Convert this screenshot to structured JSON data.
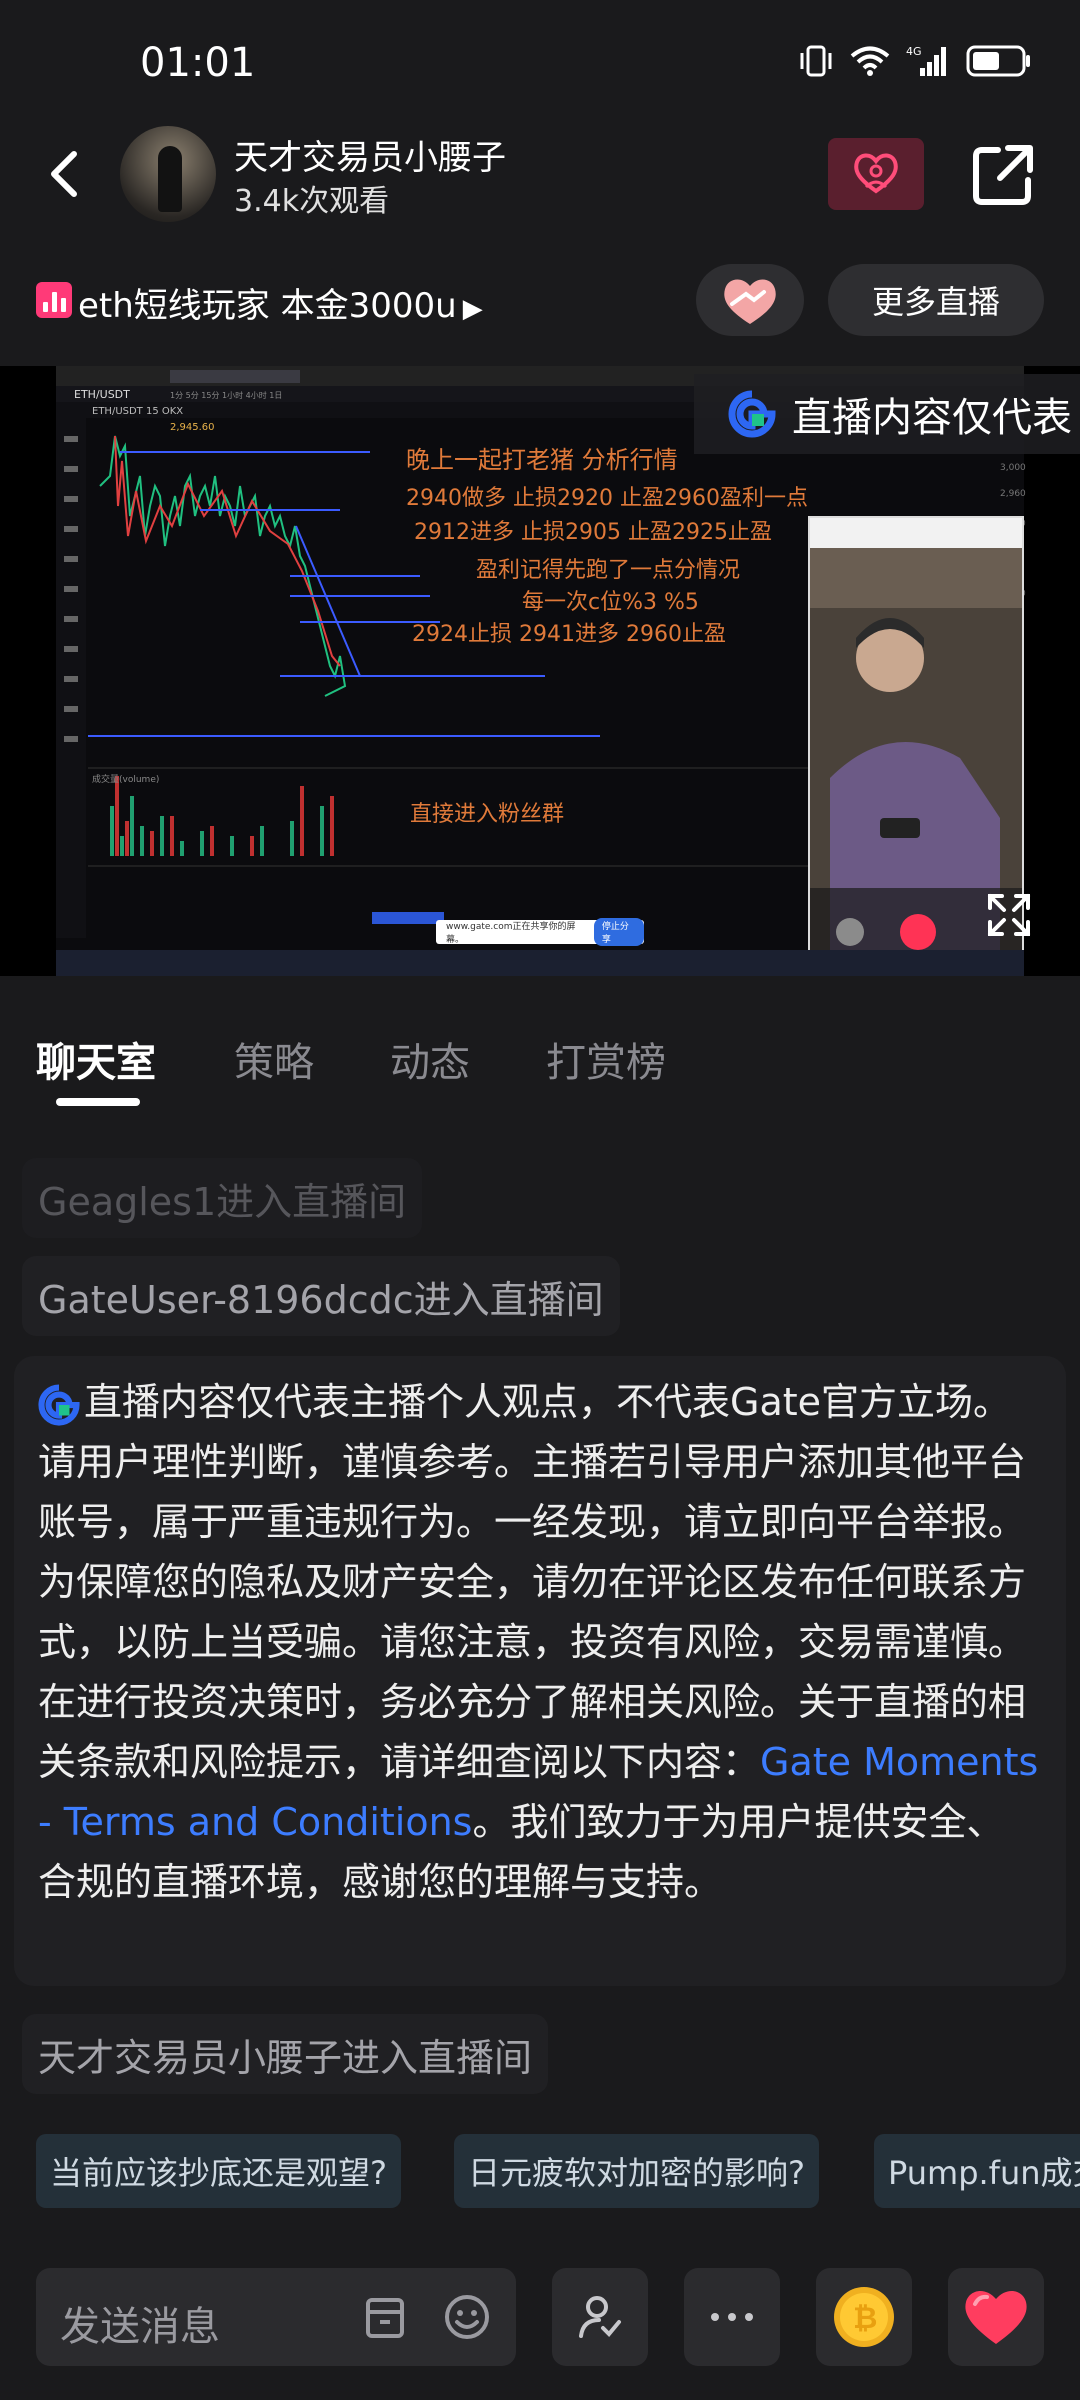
{
  "status_bar": {
    "time": "01:01",
    "network": "4G"
  },
  "header": {
    "streamer_name": "天才交易员小腰子",
    "view_count": "3.4k次观看"
  },
  "sub_header": {
    "room_title": "eth短线玩家  本金3000u",
    "more_live_label": "更多直播"
  },
  "video": {
    "disclaimer_banner": "直播内容仅代表",
    "symbol": "ETH/USDT",
    "price": "2,945.60",
    "overlay_lines": [
      "晚上一起打老猪  分析行情",
      "2940做多 止损2920 止盈2960盈利一点",
      "2912进多 止损2905 止盈2925止盈",
      "盈利记得先跑了一点分情况",
      "每一次c位%3  %5",
      "2924止损 2941进多 2960止盈",
      "直接进入粉丝群"
    ],
    "volume_label": "成交量(volume)",
    "ad_text": "www.gate.com正在共享你的屏幕。",
    "ad_button": "停止分享"
  },
  "tabs": [
    {
      "label": "聊天室",
      "active": true
    },
    {
      "label": "策略",
      "active": false
    },
    {
      "label": "动态",
      "active": false
    },
    {
      "label": "打赏榜",
      "active": false
    }
  ],
  "chat": {
    "messages": [
      "Geagles1进入直播间",
      "GateUser-8196dcdc进入直播间"
    ],
    "notice_text": "直播内容仅代表主播个人观点，不代表Gate官方立场。请用户理性判断，谨慎参考。主播若引导用户添加其他平台账号，属于严重违规行为。一经发现，请立即向平台举报。为保障您的隐私及财产安全，请勿在评论区发布任何联系方式，以防上当受骗。请您注意，投资有风险，交易需谨慎。在进行投资决策时，务必充分了解相关风险。关于直播的相关条款和风险提示，请详细查阅以下内容：",
    "notice_link": "Gate Moments - Terms and Conditions",
    "notice_tail": "。我们致力于为用户提供安全、合规的直播环境，感谢您的理解与支持。",
    "last_message": "天才交易员小腰子进入直播间"
  },
  "suggestions": [
    "当前应该抄底还是观望?",
    "日元疲软对加密的影响?",
    "Pump.fun成交"
  ],
  "bottom_bar": {
    "send_placeholder": "发送消息"
  },
  "colors": {
    "background": "#1a1a1c",
    "accent_link": "#3d7dff",
    "follow_bg": "#5a1f2e",
    "follow_icon": "#ff4d7a",
    "chart_text": "#e07a3a",
    "coin": "#f0b020",
    "heart": "#ff3d5f"
  }
}
